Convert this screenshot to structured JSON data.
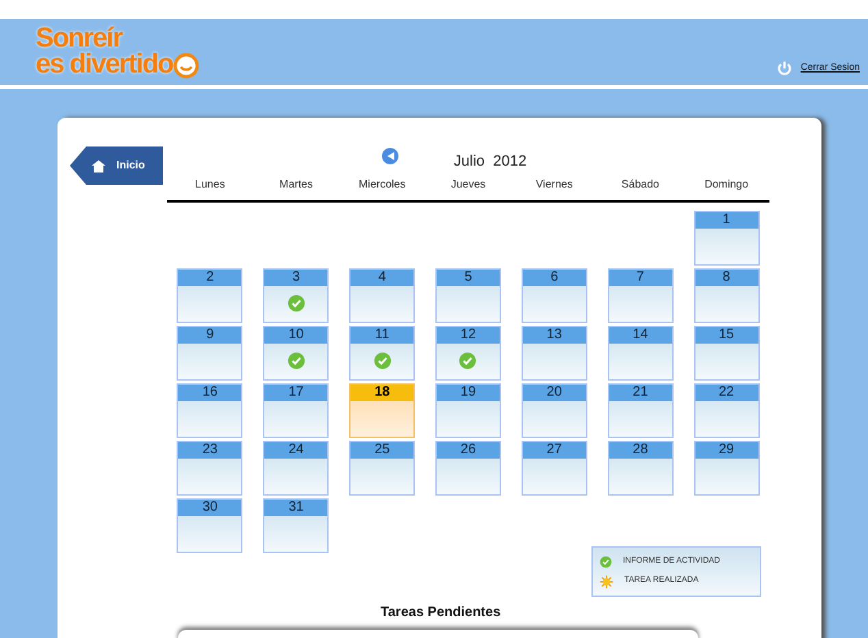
{
  "header": {
    "logo_line1": "Sonreír",
    "logo_line2": "es divertido",
    "logout": "Cerrar Sesion"
  },
  "home_button": "Inicio",
  "calendar": {
    "month": "Julio  2012",
    "weekdays": [
      "Lunes",
      "Martes",
      "Miercoles",
      "Jueves",
      "Viernes",
      "Sábado",
      "Domingo"
    ],
    "weeks": [
      {
        "kind": "trailing",
        "days": [
          {
            "day": "1",
            "today": false,
            "report": false
          }
        ]
      },
      {
        "kind": "leading",
        "days": [
          {
            "day": "2",
            "today": false,
            "report": false
          },
          {
            "day": "3",
            "today": false,
            "report": true
          },
          {
            "day": "4",
            "today": false,
            "report": false
          },
          {
            "day": "5",
            "today": false,
            "report": false
          },
          {
            "day": "6",
            "today": false,
            "report": false
          },
          {
            "day": "7",
            "today": false,
            "report": false
          },
          {
            "day": "8",
            "today": false,
            "report": false
          }
        ]
      },
      {
        "kind": "leading",
        "days": [
          {
            "day": "9",
            "today": false,
            "report": false
          },
          {
            "day": "10",
            "today": false,
            "report": true
          },
          {
            "day": "11",
            "today": false,
            "report": true
          },
          {
            "day": "12",
            "today": false,
            "report": true
          },
          {
            "day": "13",
            "today": false,
            "report": false
          },
          {
            "day": "14",
            "today": false,
            "report": false
          },
          {
            "day": "15",
            "today": false,
            "report": false
          }
        ]
      },
      {
        "kind": "leading",
        "days": [
          {
            "day": "16",
            "today": false,
            "report": false
          },
          {
            "day": "17",
            "today": false,
            "report": false
          },
          {
            "day": "18",
            "today": true,
            "report": false
          },
          {
            "day": "19",
            "today": false,
            "report": false
          },
          {
            "day": "20",
            "today": false,
            "report": false
          },
          {
            "day": "21",
            "today": false,
            "report": false
          },
          {
            "day": "22",
            "today": false,
            "report": false
          }
        ]
      },
      {
        "kind": "leading",
        "days": [
          {
            "day": "23",
            "today": false,
            "report": false
          },
          {
            "day": "24",
            "today": false,
            "report": false
          },
          {
            "day": "25",
            "today": false,
            "report": false
          },
          {
            "day": "26",
            "today": false,
            "report": false
          },
          {
            "day": "27",
            "today": false,
            "report": false
          },
          {
            "day": "28",
            "today": false,
            "report": false
          },
          {
            "day": "29",
            "today": false,
            "report": false
          }
        ]
      },
      {
        "kind": "leading",
        "days": [
          {
            "day": "30",
            "today": false,
            "report": false
          },
          {
            "day": "31",
            "today": false,
            "report": false
          }
        ]
      }
    ]
  },
  "legend": [
    {
      "kind": "check",
      "label": "INFORME DE ACTIVIDAD"
    },
    {
      "kind": "sun",
      "label": "TAREA REALIZADA"
    }
  ],
  "pending_title": "Tareas Pendientes"
}
